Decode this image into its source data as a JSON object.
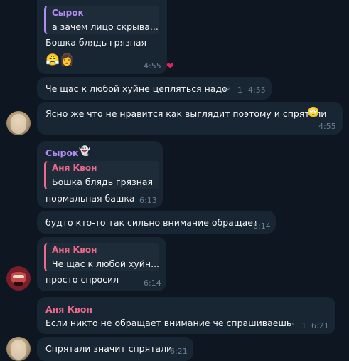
{
  "messages": [
    {
      "reply": {
        "author": "Сырок",
        "text": "а зачем лицо скрыва..."
      },
      "text": "Бошка блядь грязная",
      "stickers": [
        "😤",
        "👩"
      ],
      "time": "4:55",
      "reaction": "❤"
    },
    {
      "text": "Че щас к любой хуйне цепляться надо",
      "replies_count": "1",
      "time": "4:55"
    },
    {
      "text": "Ясно же что не нравится как выглядит поэтому и спрятали",
      "emoji": "🙄",
      "time": "4:55"
    },
    {
      "author": "Сырок",
      "author_emoji": "👻",
      "reply": {
        "author": "Аня Квон",
        "text": "Бошка блядь грязная"
      },
      "text": "нормальная башка",
      "time": "6:13"
    },
    {
      "text": "будто кто-то так сильно внимание обращает",
      "time": "6:14"
    },
    {
      "reply": {
        "author": "Аня Квон",
        "text": "Че щас к любой хуйн..."
      },
      "text": "просто спросил",
      "time": "6:14"
    },
    {
      "author": "Аня Квон",
      "text": "Если никто не обращает внимание че спрашиваешь",
      "replies_count": "1",
      "time": "6:21"
    },
    {
      "text": "Спрятали значит спрятали",
      "time": "6:21"
    }
  ],
  "colors": {
    "syrok": "#b38df2",
    "anya": "#ee6a8d",
    "bubble": "#182533",
    "background": "#0e1621"
  }
}
